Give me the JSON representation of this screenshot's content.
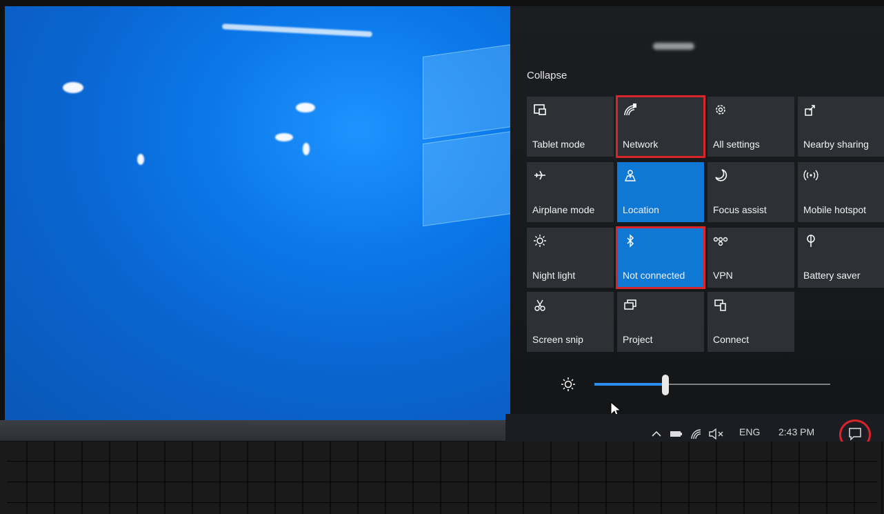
{
  "action_center": {
    "collapse_label": "Collapse",
    "tiles": [
      {
        "label": "Tablet mode",
        "icon": "tablet-mode-icon",
        "active": false,
        "highlighted": false
      },
      {
        "label": "Network",
        "icon": "network-icon",
        "active": false,
        "highlighted": true
      },
      {
        "label": "All settings",
        "icon": "gear-icon",
        "active": false,
        "highlighted": false
      },
      {
        "label": "Nearby sharing",
        "icon": "nearby-sharing-icon",
        "active": false,
        "highlighted": false
      },
      {
        "label": "Airplane mode",
        "icon": "airplane-icon",
        "active": false,
        "highlighted": false
      },
      {
        "label": "Location",
        "icon": "location-icon",
        "active": true,
        "highlighted": false
      },
      {
        "label": "Focus assist",
        "icon": "moon-icon",
        "active": false,
        "highlighted": false
      },
      {
        "label": "Mobile hotspot",
        "icon": "hotspot-icon",
        "active": false,
        "highlighted": false
      },
      {
        "label": "Night light",
        "icon": "night-light-icon",
        "active": false,
        "highlighted": false
      },
      {
        "label": "Not connected",
        "icon": "bluetooth-icon",
        "active": true,
        "highlighted": true
      },
      {
        "label": "VPN",
        "icon": "vpn-icon",
        "active": false,
        "highlighted": false
      },
      {
        "label": "Battery saver",
        "icon": "battery-saver-icon",
        "active": false,
        "highlighted": false
      },
      {
        "label": "Screen snip",
        "icon": "screen-snip-icon",
        "active": false,
        "highlighted": false
      },
      {
        "label": "Project",
        "icon": "project-icon",
        "active": false,
        "highlighted": false
      },
      {
        "label": "Connect",
        "icon": "connect-icon",
        "active": false,
        "highlighted": false
      }
    ],
    "brightness_fraction": 0.3
  },
  "taskbar": {
    "language": "ENG",
    "time": "2:43 PM",
    "icons": [
      "chevron-up-icon",
      "battery-icon",
      "wifi-icon",
      "volume-muted-icon",
      "action-center-icon"
    ]
  },
  "colors": {
    "tile_active": "#0f78d4",
    "tile_inactive": "#2d3035",
    "highlight_red": "#d9242a"
  }
}
